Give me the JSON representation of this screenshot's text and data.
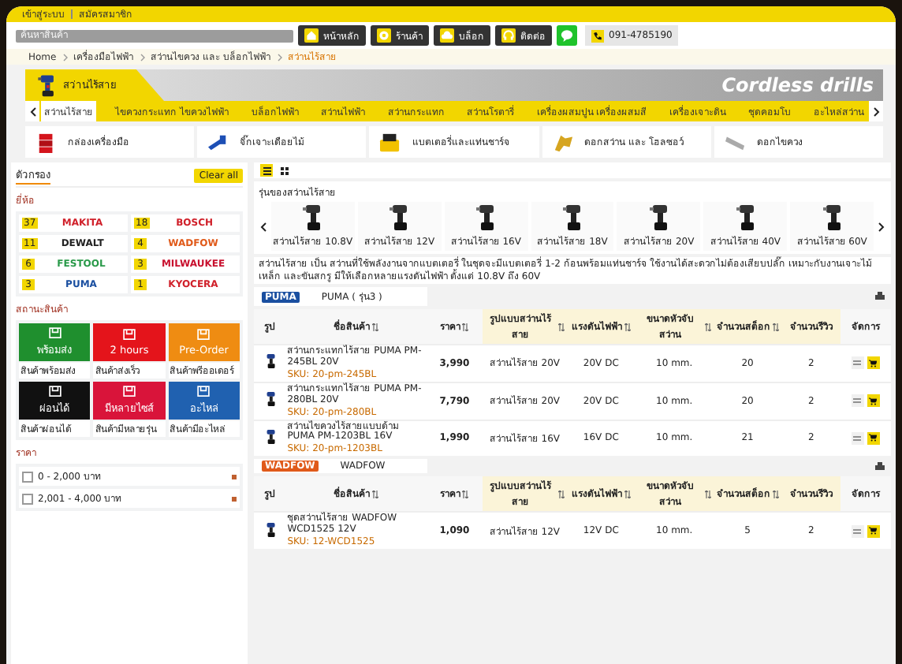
{
  "top_bar": {
    "links": [
      "เข้าสู่ระบบ",
      "สมัครสมาชิก"
    ]
  },
  "header": {
    "search": {
      "placeholder": "ค้นหาสินค้า"
    },
    "nav_buttons": [
      {
        "kind": "home",
        "label": "หน้าหลัก"
      },
      {
        "kind": "shop",
        "label": "ร้านค้า"
      },
      {
        "kind": "blog",
        "label": "บล็อก"
      },
      {
        "kind": "contact",
        "label": "ติดต่อ"
      }
    ],
    "phone": "091-4785190"
  },
  "breadcrumb": [
    {
      "label": "Home",
      "selected": false
    },
    {
      "label": "เครื่องมือไฟฟ้า",
      "selected": false
    },
    {
      "label": "สว่านไขควง และ บล็อกไฟฟ้า",
      "selected": false
    },
    {
      "label": "สว่านไร้สาย",
      "selected": true
    }
  ],
  "banner": {
    "title": "สว่านไร้สาย",
    "subtitle": "Cordless drills"
  },
  "category_tabs": [
    {
      "label": "สว่านไร้สาย",
      "selected": true
    },
    {
      "label": "ไขควงกระแทก ไขควงไฟฟ้า",
      "selected": false
    },
    {
      "label": "บล็อกไฟฟ้า",
      "selected": false
    },
    {
      "label": "สว่านไฟฟ้า",
      "selected": false
    },
    {
      "label": "สว่านกระแทก",
      "selected": false
    },
    {
      "label": "สว่านโรตารี่",
      "selected": false
    },
    {
      "label": "เครื่องผสมปูน เครื่องผสมสี",
      "selected": false
    },
    {
      "label": "เครื่องเจาะดิน",
      "selected": false
    },
    {
      "label": "ชุดคอมโบ",
      "selected": false
    },
    {
      "label": "อะไหล่สว่าน",
      "selected": false
    }
  ],
  "subcategories": [
    {
      "kind": "toolbox",
      "label": "กล่องเครื่องมือ"
    },
    {
      "kind": "jig",
      "label": "จิ๊กเจาะเดือยไม้"
    },
    {
      "kind": "battery",
      "label": "แบตเตอรี่และแท่นชาร์จ"
    },
    {
      "kind": "drillbit",
      "label": "ดอกสว่าน และ โฮลซอว์"
    },
    {
      "kind": "screwbit",
      "label": "ดอกไขควง"
    }
  ],
  "filters": {
    "title": "ตัวกรอง",
    "clear": "Clear all",
    "brand_title": "ยี่ห้อ",
    "brands": [
      {
        "count": "37",
        "name": "MAKITA",
        "color": "#d0202a"
      },
      {
        "count": "18",
        "name": "BOSCH",
        "color": "#d0202a"
      },
      {
        "count": "11",
        "name": "DEWALT",
        "color": "#222222"
      },
      {
        "count": "4",
        "name": "WADFOW",
        "color": "#e05a1a"
      },
      {
        "count": "6",
        "name": "FESTOOL",
        "color": "#2a9a4a"
      },
      {
        "count": "3",
        "name": "MILWAUKEE",
        "color": "#c8102e"
      },
      {
        "count": "3",
        "name": "PUMA",
        "color": "#1a4fa0"
      },
      {
        "count": "1",
        "name": "KYOCERA",
        "color": "#d0202a"
      }
    ],
    "status_title": "สถานะสินค้า",
    "statuses": [
      {
        "label": "พร้อมส่ง",
        "caption": "สินค้าพร้อมส่ง",
        "color": "#1f8f2e"
      },
      {
        "label": "2 hours",
        "caption": "สินค้าส่งเร็ว",
        "color": "#e4141b"
      },
      {
        "label": "Pre-Order",
        "caption": "สินค้าพรีออเดอร์",
        "color": "#ef8c12"
      },
      {
        "label": "ผ่อนได้",
        "caption": "สินค้าผ่อนได้",
        "color": "#111111"
      },
      {
        "label": "มีหลายไซส์",
        "caption": "สินค้ามีหลายรุ่น",
        "color": "#d9143a"
      },
      {
        "label": "อะไหล่",
        "caption": "สินค้ามีอะไหล่",
        "color": "#2061b0"
      }
    ],
    "price_title": "ราคา",
    "prices": [
      {
        "label": "0 - 2,000 บาท",
        "checked": false
      },
      {
        "label": "2,001 - 4,000 บาท",
        "checked": false
      }
    ]
  },
  "view_toggle": [
    {
      "kind": "list",
      "selected": true
    },
    {
      "kind": "grid",
      "selected": false
    }
  ],
  "models": {
    "title": "รุ่นของสว่านไร้สาย",
    "items": [
      "สว่านไร้สาย 10.8V",
      "สว่านไร้สาย 12V",
      "สว่านไร้สาย 16V",
      "สว่านไร้สาย 18V",
      "สว่านไร้สาย 20V",
      "สว่านไร้สาย 40V",
      "สว่านไร้สาย 60V"
    ]
  },
  "description": "สว่านไร้สาย เป็น สว่านที่ใช้พลังงานจากแบตเตอรี่ ในชุดจะมีแบตเตอรี่ 1-2 ก้อนพร้อมแท่นชาร์จ ใช้งานได้สะดวกไม่ต้องเสียบปลั๊ก เหมาะกับงานเจาะไม้ เหล็ก และขันสกรู มีให้เลือกหลายแรงดันไฟฟ้า ตั้งแต่ 10.8V ถึง 60V",
  "brand_groups": [
    {
      "logo": "PUMA",
      "color": "#1a4fa0",
      "title": "PUMA ( รุ่น3 )",
      "columns": [
        {
          "label": "รูป",
          "sortable": false,
          "highlight": false
        },
        {
          "label": "ชื่อสินค้า",
          "sortable": true,
          "highlight": false
        },
        {
          "label": "ราคา",
          "sortable": true,
          "highlight": false
        },
        {
          "label": "รูปแบบสว่านไร้สาย",
          "sortable": true,
          "highlight": true
        },
        {
          "label": "แรงดันไฟฟ้า",
          "sortable": true,
          "highlight": true
        },
        {
          "label": "ขนาดหัวจับสว่าน",
          "sortable": true,
          "highlight": true
        },
        {
          "label": "จำนวนสต็อก",
          "sortable": true,
          "highlight": true
        },
        {
          "label": "จำนวนรีวิว",
          "sortable": false,
          "highlight": true
        },
        {
          "label": "จัดการ",
          "sortable": false,
          "highlight": false
        }
      ],
      "rows": [
        {
          "name": "สว่านกระแทกไร้สาย PUMA PM-245BL 20V",
          "sku": "SKU: 20-pm-245BL",
          "price": "3,990",
          "type": "สว่านไร้สาย 20V",
          "voltage": "20V DC",
          "chuck": "10 mm.",
          "stock": "20",
          "reviews": "2"
        },
        {
          "name": "สว่านกระแทกไร้สาย PUMA PM-280BL 20V",
          "sku": "SKU: 20-pm-280BL",
          "price": "7,790",
          "type": "สว่านไร้สาย 20V",
          "voltage": "20V DC",
          "chuck": "10 mm.",
          "stock": "20",
          "reviews": "2"
        },
        {
          "name": "สว่านไขควงไร้สายแบบด้าม PUMA PM-1203BL 16V",
          "sku": "SKU: 20-pm-1203BL",
          "price": "1,990",
          "type": "สว่านไร้สาย 16V",
          "voltage": "16V DC",
          "chuck": "10 mm.",
          "stock": "21",
          "reviews": "2"
        }
      ]
    },
    {
      "logo": "WADFOW",
      "color": "#e05a1a",
      "title": "WADFOW",
      "columns": [
        {
          "label": "รูป",
          "sortable": false,
          "highlight": false
        },
        {
          "label": "ชื่อสินค้า",
          "sortable": true,
          "highlight": false
        },
        {
          "label": "ราคา",
          "sortable": true,
          "highlight": false
        },
        {
          "label": "รูปแบบสว่านไร้สาย",
          "sortable": true,
          "highlight": true
        },
        {
          "label": "แรงดันไฟฟ้า",
          "sortable": true,
          "highlight": true
        },
        {
          "label": "ขนาดหัวจับสว่าน",
          "sortable": true,
          "highlight": true
        },
        {
          "label": "จำนวนสต็อก",
          "sortable": true,
          "highlight": true
        },
        {
          "label": "จำนวนรีวิว",
          "sortable": false,
          "highlight": true
        },
        {
          "label": "จัดการ",
          "sortable": false,
          "highlight": false
        }
      ],
      "rows": [
        {
          "name": "ชุดสว่านไร้สาย WADFOW WCD1525 12V",
          "sku": "SKU: 12-WCD1525",
          "price": "1,090",
          "type": "สว่านไร้สาย 12V",
          "voltage": "12V DC",
          "chuck": "10 mm.",
          "stock": "5",
          "reviews": "2"
        }
      ]
    }
  ]
}
